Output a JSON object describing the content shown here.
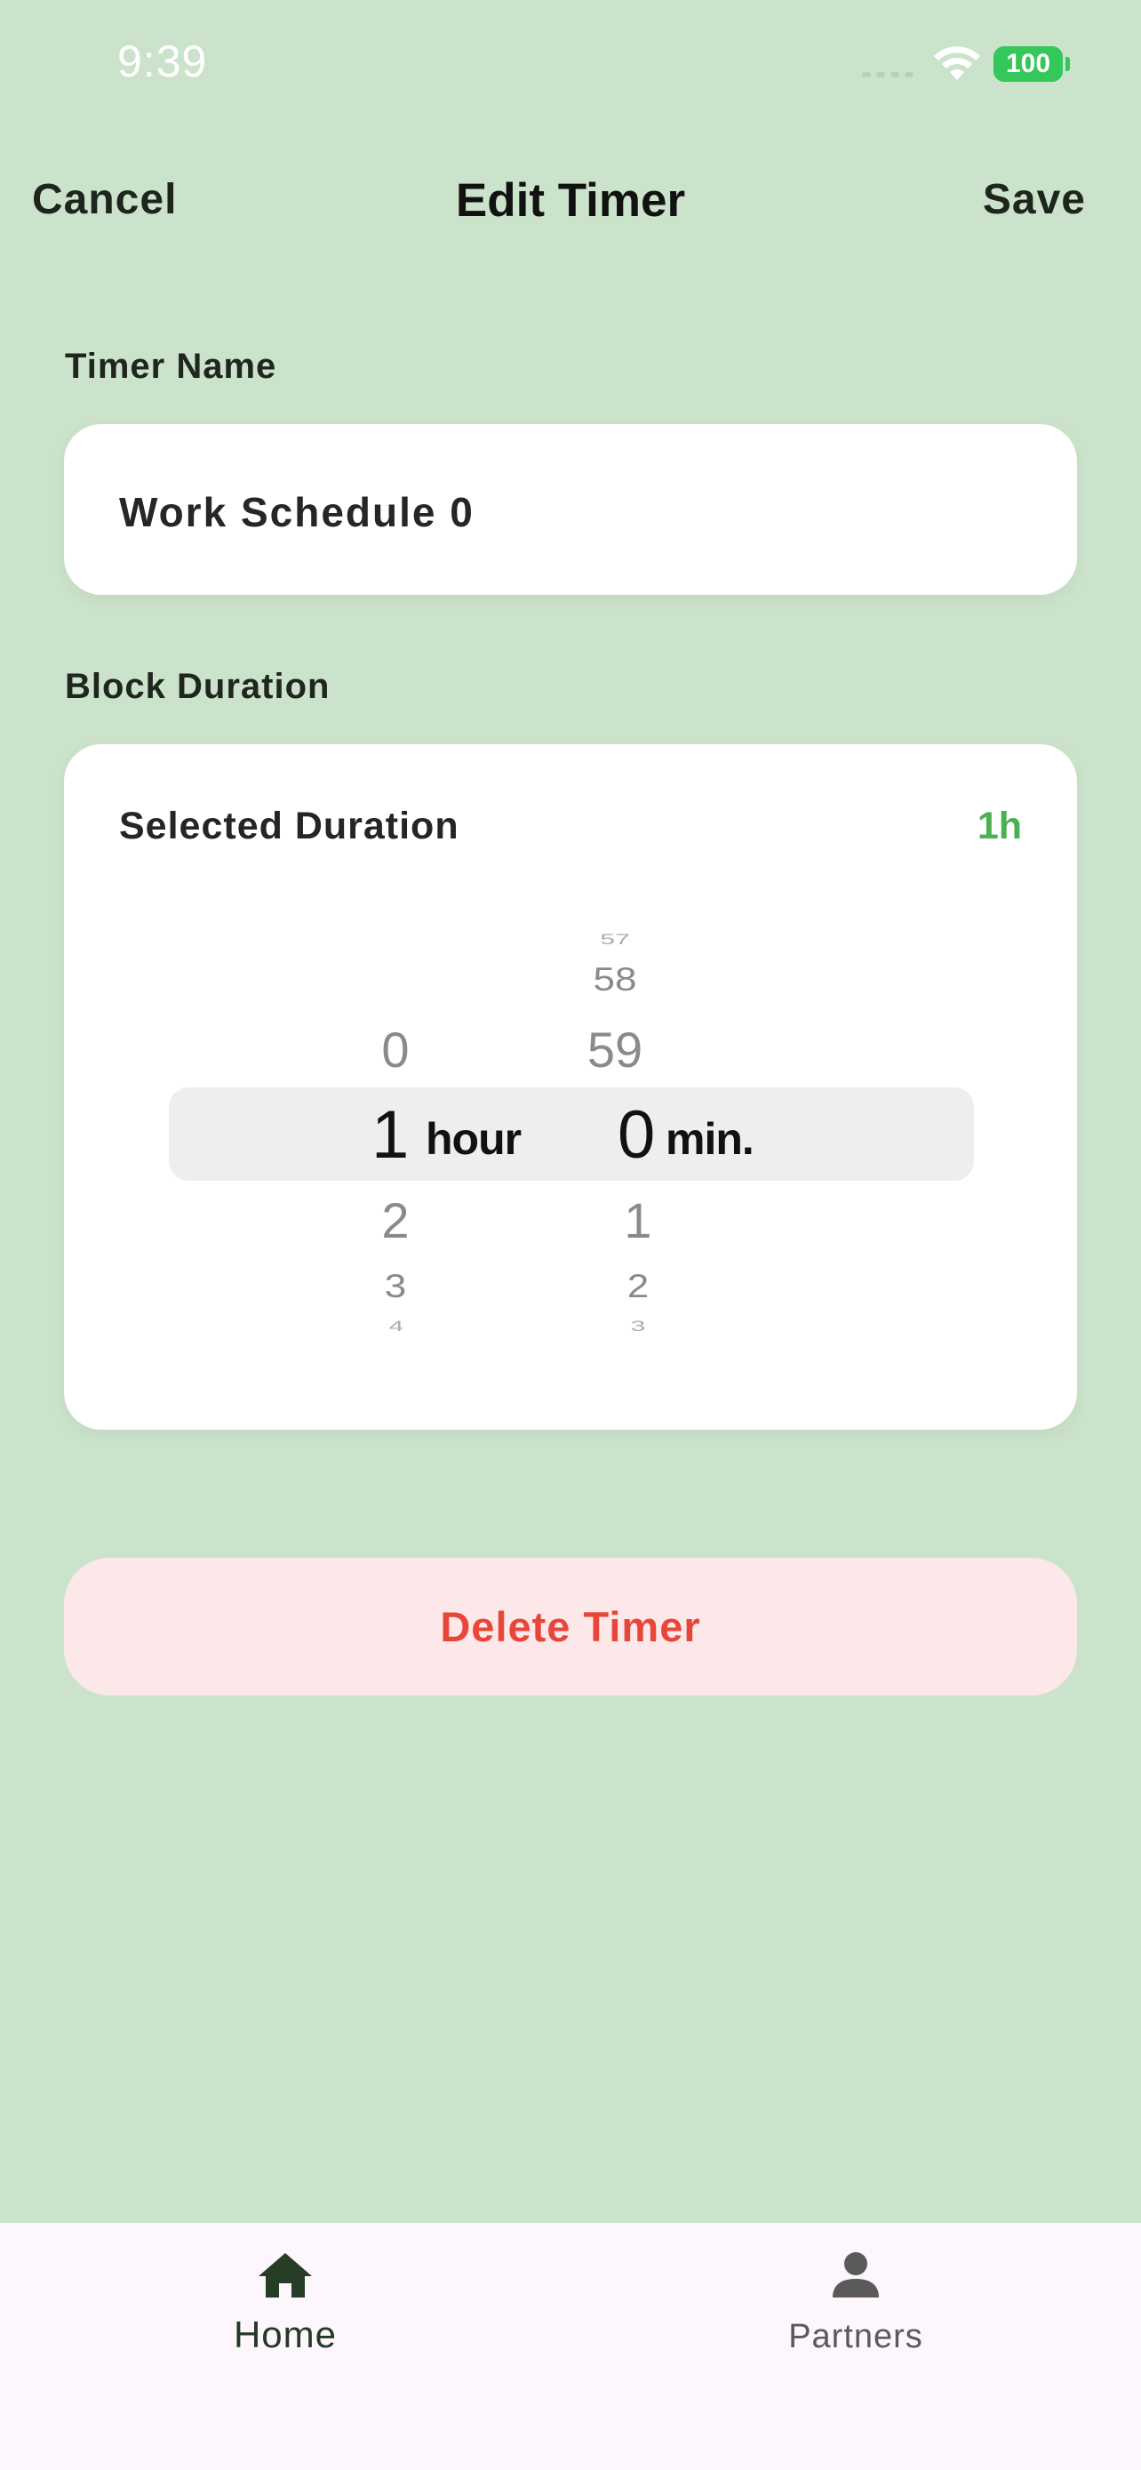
{
  "status_bar": {
    "time": "9:39",
    "battery": "100",
    "wifi_icon": "wifi-icon",
    "signal_icon": "cellular-dots-icon"
  },
  "nav": {
    "cancel_label": "Cancel",
    "title": "Edit Timer",
    "save_label": "Save"
  },
  "timer_name": {
    "label": "Timer Name",
    "value": "Work Schedule 0"
  },
  "block_duration": {
    "label": "Block Duration",
    "selected_label": "Selected Duration",
    "selected_value": "1h",
    "hours": {
      "above": [
        "0"
      ],
      "selected": "1",
      "below": [
        "2",
        "3",
        "4"
      ],
      "unit": "hour"
    },
    "minutes": {
      "above": [
        "57",
        "58",
        "59"
      ],
      "selected": "0",
      "below": [
        "1",
        "2",
        "3"
      ],
      "unit": "min."
    }
  },
  "delete_label": "Delete Timer",
  "tabbar": {
    "home": {
      "label": "Home",
      "icon": "home-icon"
    },
    "partners": {
      "label": "Partners",
      "icon": "person-icon"
    }
  },
  "colors": {
    "background": "#cce3cb",
    "accent": "#4caf50",
    "danger": "#e8463a",
    "danger_bg": "#fde8e9",
    "battery": "#34c759"
  }
}
